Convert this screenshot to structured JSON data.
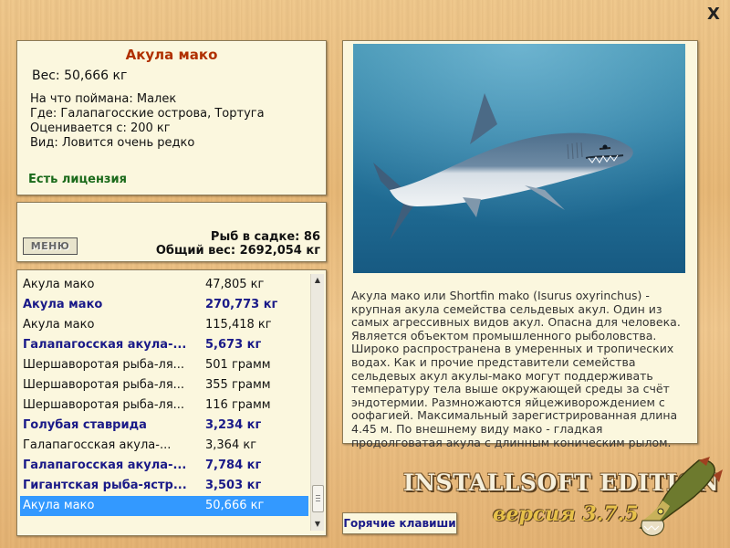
{
  "window": {
    "close_label": "X"
  },
  "fish_info": {
    "title": "Акула мако",
    "weight": "Вес: 50,666 кг",
    "caught_with": "На что поймана: Малек",
    "location": "Где: Галапагосские острова, Тортуга",
    "valued_from": "Оценивается с: 200 кг",
    "species_rarity": "Вид: Ловится очень редко",
    "license": "Есть лицензия"
  },
  "stats": {
    "menu_label": "МЕНЮ",
    "fish_in_keepnet": "Рыб в садке: 86",
    "total_weight": "Общий вес: 2692,054 кг"
  },
  "catch_list": [
    {
      "name": "Акула мако",
      "weight": "47,805 кг",
      "bold": false,
      "selected": false
    },
    {
      "name": "Акула мако",
      "weight": "270,773 кг",
      "bold": true,
      "selected": false
    },
    {
      "name": "Акула мако",
      "weight": "115,418 кг",
      "bold": false,
      "selected": false
    },
    {
      "name": "Галапагосская акула-...",
      "weight": "5,673 кг",
      "bold": true,
      "selected": false
    },
    {
      "name": "Шершаворотая рыба-ля...",
      "weight": "501 грамм",
      "bold": false,
      "selected": false
    },
    {
      "name": "Шершаворотая рыба-ля...",
      "weight": "355 грамм",
      "bold": false,
      "selected": false
    },
    {
      "name": "Шершаворотая рыба-ля...",
      "weight": "116 грамм",
      "bold": false,
      "selected": false
    },
    {
      "name": "Голубая ставрида",
      "weight": "3,234 кг",
      "bold": true,
      "selected": false
    },
    {
      "name": "Галапагосская акула-...",
      "weight": "3,364 кг",
      "bold": false,
      "selected": false
    },
    {
      "name": "Галапагосская акула-...",
      "weight": "7,784 кг",
      "bold": true,
      "selected": false
    },
    {
      "name": "Гигантская рыба-ястр...",
      "weight": "3,503 кг",
      "bold": true,
      "selected": false
    },
    {
      "name": "Акула мако",
      "weight": "50,666 кг",
      "bold": false,
      "selected": true
    }
  ],
  "description": {
    "text": "Акула мако или Shortfin mako (Isurus oxyrinchus) - крупная акула семейства сельдевых акул. Один из самых агрессивных видов акул. Опасна для человека. Является объектом промышленного рыболовства. Широко распространена в умеренных и тропических водах. Как и прочие представители семейства сельдевых акул акулы-мако могут поддерживать температуру тела выше окружающей среды за счёт эндотермии. Размножаются яйцеживорождением с оофагией. Максимальный зарегистрированная длина 4.45 м. По внешнему виду мако - гладкая продолговатая акула с длинным коническим рылом."
  },
  "footer": {
    "hotkeys_label": "Горячие клавиши",
    "edition": "INSTALLSOFT EDITION",
    "version": "версия 3.7.5"
  },
  "colors": {
    "selected_row": "#3399ff",
    "bold_row": "#1a1a88",
    "title": "#b03000",
    "license": "#1a6a1a"
  }
}
